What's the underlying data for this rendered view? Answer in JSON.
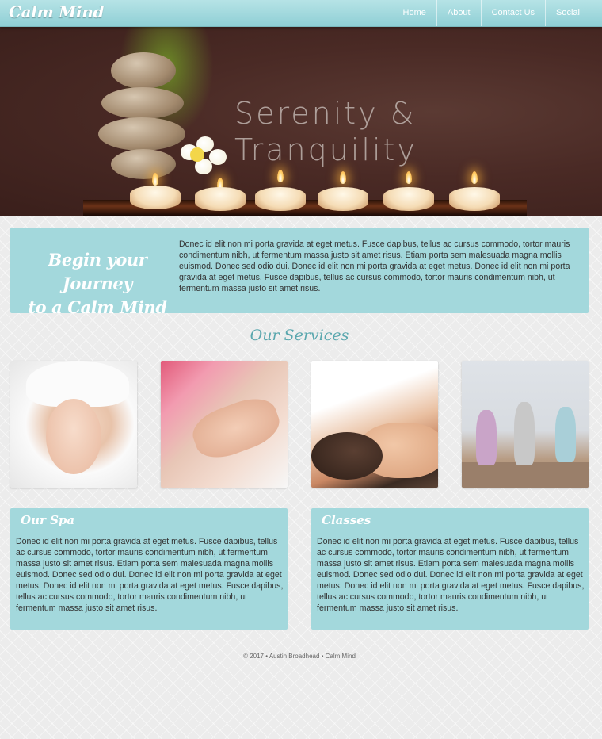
{
  "brand": "Calm Mind",
  "nav": [
    "Home",
    "About",
    "Contact Us",
    "Social"
  ],
  "hero": {
    "line1": "Serenity &",
    "line2": "Tranquility"
  },
  "journey": {
    "title_line1": "Begin your Journey",
    "title_line2": "to a Calm Mind",
    "text": "Donec id elit non mi porta gravida at eget metus. Fusce dapibus, tellus ac cursus commodo, tortor mauris condimentum nibh, ut fermentum massa justo sit amet risus. Etiam porta sem malesuada magna mollis euismod. Donec sed odio dui. Donec id elit non mi porta gravida at eget metus. Donec id elit non mi porta gravida at eget metus. Fusce dapibus, tellus ac cursus commodo, tortor mauris condimentum nibh, ut fermentum massa justo sit amet risus."
  },
  "services": {
    "title": "Our Services",
    "images": [
      "facial-treatment",
      "manicure",
      "massage",
      "yoga-class"
    ]
  },
  "spa": {
    "title": "Our Spa",
    "text": "Donec id elit non mi porta gravida at eget metus. Fusce dapibus, tellus ac cursus commodo, tortor mauris condimentum nibh, ut fermentum massa justo sit amet risus. Etiam porta sem malesuada magna mollis euismod. Donec sed odio dui. Donec id elit non mi porta gravida at eget metus. Donec id elit non mi porta gravida at eget metus. Fusce dapibus, tellus ac cursus commodo, tortor mauris condimentum nibh, ut fermentum massa justo sit amet risus."
  },
  "classes": {
    "title": "Classes",
    "text": "Donec id elit non mi porta gravida at eget metus. Fusce dapibus, tellus ac cursus commodo, tortor mauris condimentum nibh, ut fermentum massa justo sit amet risus. Etiam porta sem malesuada magna mollis euismod. Donec sed odio dui. Donec id elit non mi porta gravida at eget metus. Donec id elit non mi porta gravida at eget metus. Fusce dapibus, tellus ac cursus commodo, tortor mauris condimentum nibh, ut fermentum massa justo sit amet risus."
  },
  "footer": "© 2017 • Austin Broadhead • Calm Mind",
  "colors": {
    "accent": "#a3d8dc",
    "heading": "#5aa7ae",
    "nav": "#9fd8dc"
  }
}
